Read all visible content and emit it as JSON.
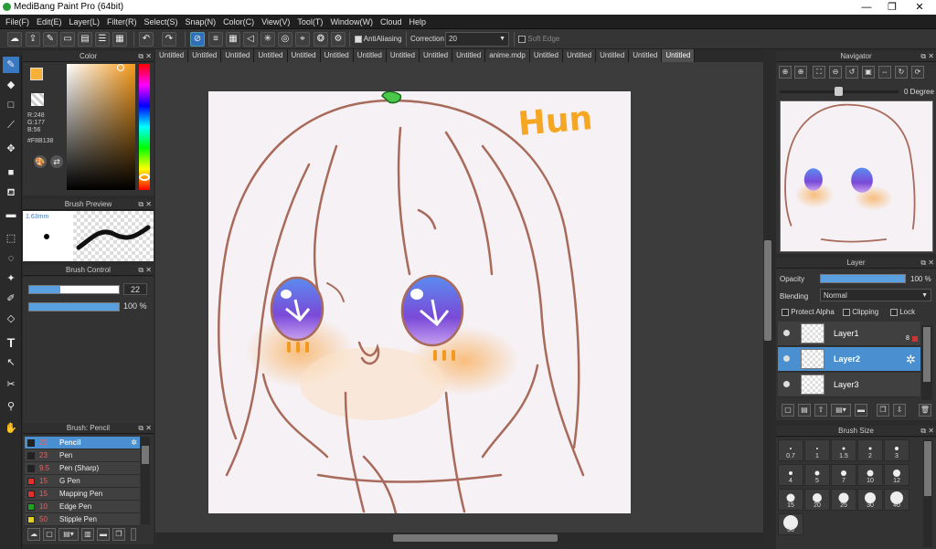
{
  "app": {
    "title": "MediBang Paint Pro (64bit)"
  },
  "window_controls": {
    "minimize": "—",
    "maximize": "❐",
    "close": "✕"
  },
  "menu": [
    "File(F)",
    "Edit(E)",
    "Layer(L)",
    "Filter(R)",
    "Select(S)",
    "Snap(N)",
    "Color(C)",
    "View(V)",
    "Tool(T)",
    "Window(W)",
    "Cloud",
    "Help"
  ],
  "toolbar": {
    "antialiasing_label": "AntiAliasing",
    "correction_label": "Correction",
    "correction_value": "20",
    "soft_edge_label": "Soft Edge"
  },
  "color_panel": {
    "title": "Color",
    "r": "R:248",
    "g": "G:177",
    "b": "B:56",
    "hex": "#F8B138",
    "fg_color": "#F8B138",
    "bg_color": "#FFFFFF"
  },
  "brush_preview": {
    "title": "Brush Preview",
    "size": "1.63mm"
  },
  "brush_control": {
    "title": "Brush Control",
    "size_value": "22",
    "size_fill": 0.35,
    "opacity_value": "100 %",
    "opacity_fill": 1.0
  },
  "brush_list": {
    "title": "Brush: Pencil",
    "items": [
      {
        "num": "22",
        "name": "Pencil",
        "color": "#222222",
        "active": true
      },
      {
        "num": "23",
        "name": "Pen",
        "color": "#222222",
        "active": false
      },
      {
        "num": "9.5",
        "name": "Pen (Sharp)",
        "color": "#222222",
        "active": false
      },
      {
        "num": "15",
        "name": "G Pen",
        "color": "#e03030",
        "active": false
      },
      {
        "num": "15",
        "name": "Mapping Pen",
        "color": "#e03030",
        "active": false
      },
      {
        "num": "10",
        "name": "Edge Pen",
        "color": "#20a020",
        "active": false
      },
      {
        "num": "50",
        "name": "Stipple Pen",
        "color": "#e0d020",
        "active": false
      }
    ]
  },
  "tabs": [
    "Untitled",
    "Untitled",
    "Untitled",
    "Untitled",
    "Untitled",
    "Untitled",
    "Untitled",
    "Untitled",
    "Untitled",
    "Untitled",
    "anime.mdp",
    "Untitled",
    "Untitled",
    "Untitled",
    "Untitled",
    "Untitled"
  ],
  "active_tab_index": 15,
  "canvas": {
    "signature": "Hun"
  },
  "navigator": {
    "title": "Navigator",
    "rotation": "0 Degree"
  },
  "layer_panel": {
    "title": "Layer",
    "opacity_label": "Opacity",
    "opacity_value": "100 %",
    "blending_label": "Blending",
    "blending_value": "Normal",
    "protect_alpha": "Protect Alpha",
    "clipping": "Clipping",
    "lock": "Lock",
    "layers": [
      {
        "name": "Layer1",
        "badge": "8",
        "active": false
      },
      {
        "name": "Layer2",
        "badge": "",
        "active": true
      },
      {
        "name": "Layer3",
        "badge": "",
        "active": false
      }
    ]
  },
  "brush_size": {
    "title": "Brush Size",
    "sizes": [
      "0.7",
      "1",
      "1.5",
      "2",
      "3",
      "4",
      "5",
      "7",
      "10",
      "12",
      "15",
      "20",
      "25",
      "30",
      "40",
      "50"
    ]
  }
}
